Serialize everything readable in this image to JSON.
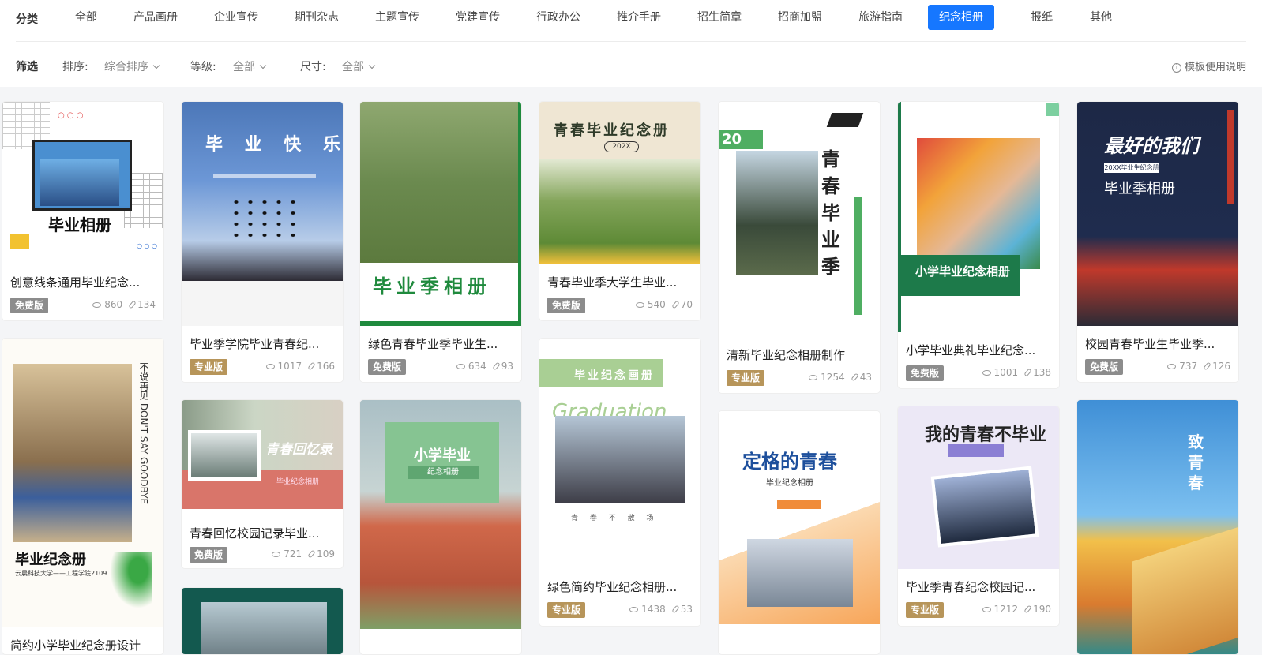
{
  "categories": {
    "label": "分类",
    "items": [
      "全部",
      "产品画册",
      "企业宣传",
      "期刊杂志",
      "主题宣传",
      "党建宣传",
      "行政办公",
      "推介手册",
      "招生简章",
      "招商加盟",
      "旅游指南",
      "纪念相册",
      "报纸",
      "其他"
    ],
    "active": "纪念相册"
  },
  "filters": {
    "label": "筛选",
    "sort_label": "排序:",
    "sort_value": "综合排序",
    "level_label": "等级:",
    "level_value": "全部",
    "size_label": "尺寸:",
    "size_value": "全部",
    "help": "模板使用说明"
  },
  "colors": {
    "accent": "#1677ff",
    "pro_badge": "#b7955a",
    "free_badge": "#8c8c8c"
  },
  "cards": [
    {
      "title": "创意线条通用毕业纪念...",
      "badge": "免费版",
      "views": "860",
      "uses": "134",
      "art": "毕业相册"
    },
    {
      "title": "毕业季学院毕业青春纪...",
      "badge": "专业版",
      "views": "1017",
      "uses": "166",
      "art": "毕 业 快 乐"
    },
    {
      "title": "绿色青春毕业季毕业生...",
      "badge": "免费版",
      "views": "634",
      "uses": "93",
      "art": "毕业季相册"
    },
    {
      "title": "青春毕业季大学生毕业...",
      "badge": "免费版",
      "views": "540",
      "uses": "70",
      "art": "青春毕业纪念册"
    },
    {
      "title": "清新毕业纪念相册制作",
      "badge": "专业版",
      "views": "1254",
      "uses": "43",
      "art": "青春毕业季"
    },
    {
      "title": "小学毕业典礼毕业纪念...",
      "badge": "免费版",
      "views": "1001",
      "uses": "138",
      "art": "小学毕业纪念相册"
    },
    {
      "title": "校园青春毕业生毕业季...",
      "badge": "免费版",
      "views": "737",
      "uses": "126",
      "art": "最好的我们"
    },
    {
      "title": "简约小学毕业纪念册设计",
      "badge": "",
      "views": "",
      "uses": "",
      "art": "毕业纪念册"
    },
    {
      "title": "青春回忆校园记录毕业...",
      "badge": "免费版",
      "views": "721",
      "uses": "109",
      "art": "青春回忆录"
    },
    {
      "title": "",
      "badge": "",
      "views": "",
      "uses": "",
      "art": "小学毕业"
    },
    {
      "title": "绿色简约毕业纪念相册...",
      "badge": "专业版",
      "views": "1438",
      "uses": "53",
      "art": "毕业纪念画册"
    },
    {
      "title": "",
      "badge": "",
      "views": "",
      "uses": "",
      "art": "定格的青春"
    },
    {
      "title": "毕业季青春纪念校园记...",
      "badge": "专业版",
      "views": "1212",
      "uses": "190",
      "art": "我的青春不毕业"
    },
    {
      "title": "",
      "badge": "",
      "views": "",
      "uses": "",
      "art": "致青春"
    },
    {
      "title": "",
      "badge": "",
      "views": "",
      "uses": "",
      "art": ""
    }
  ]
}
